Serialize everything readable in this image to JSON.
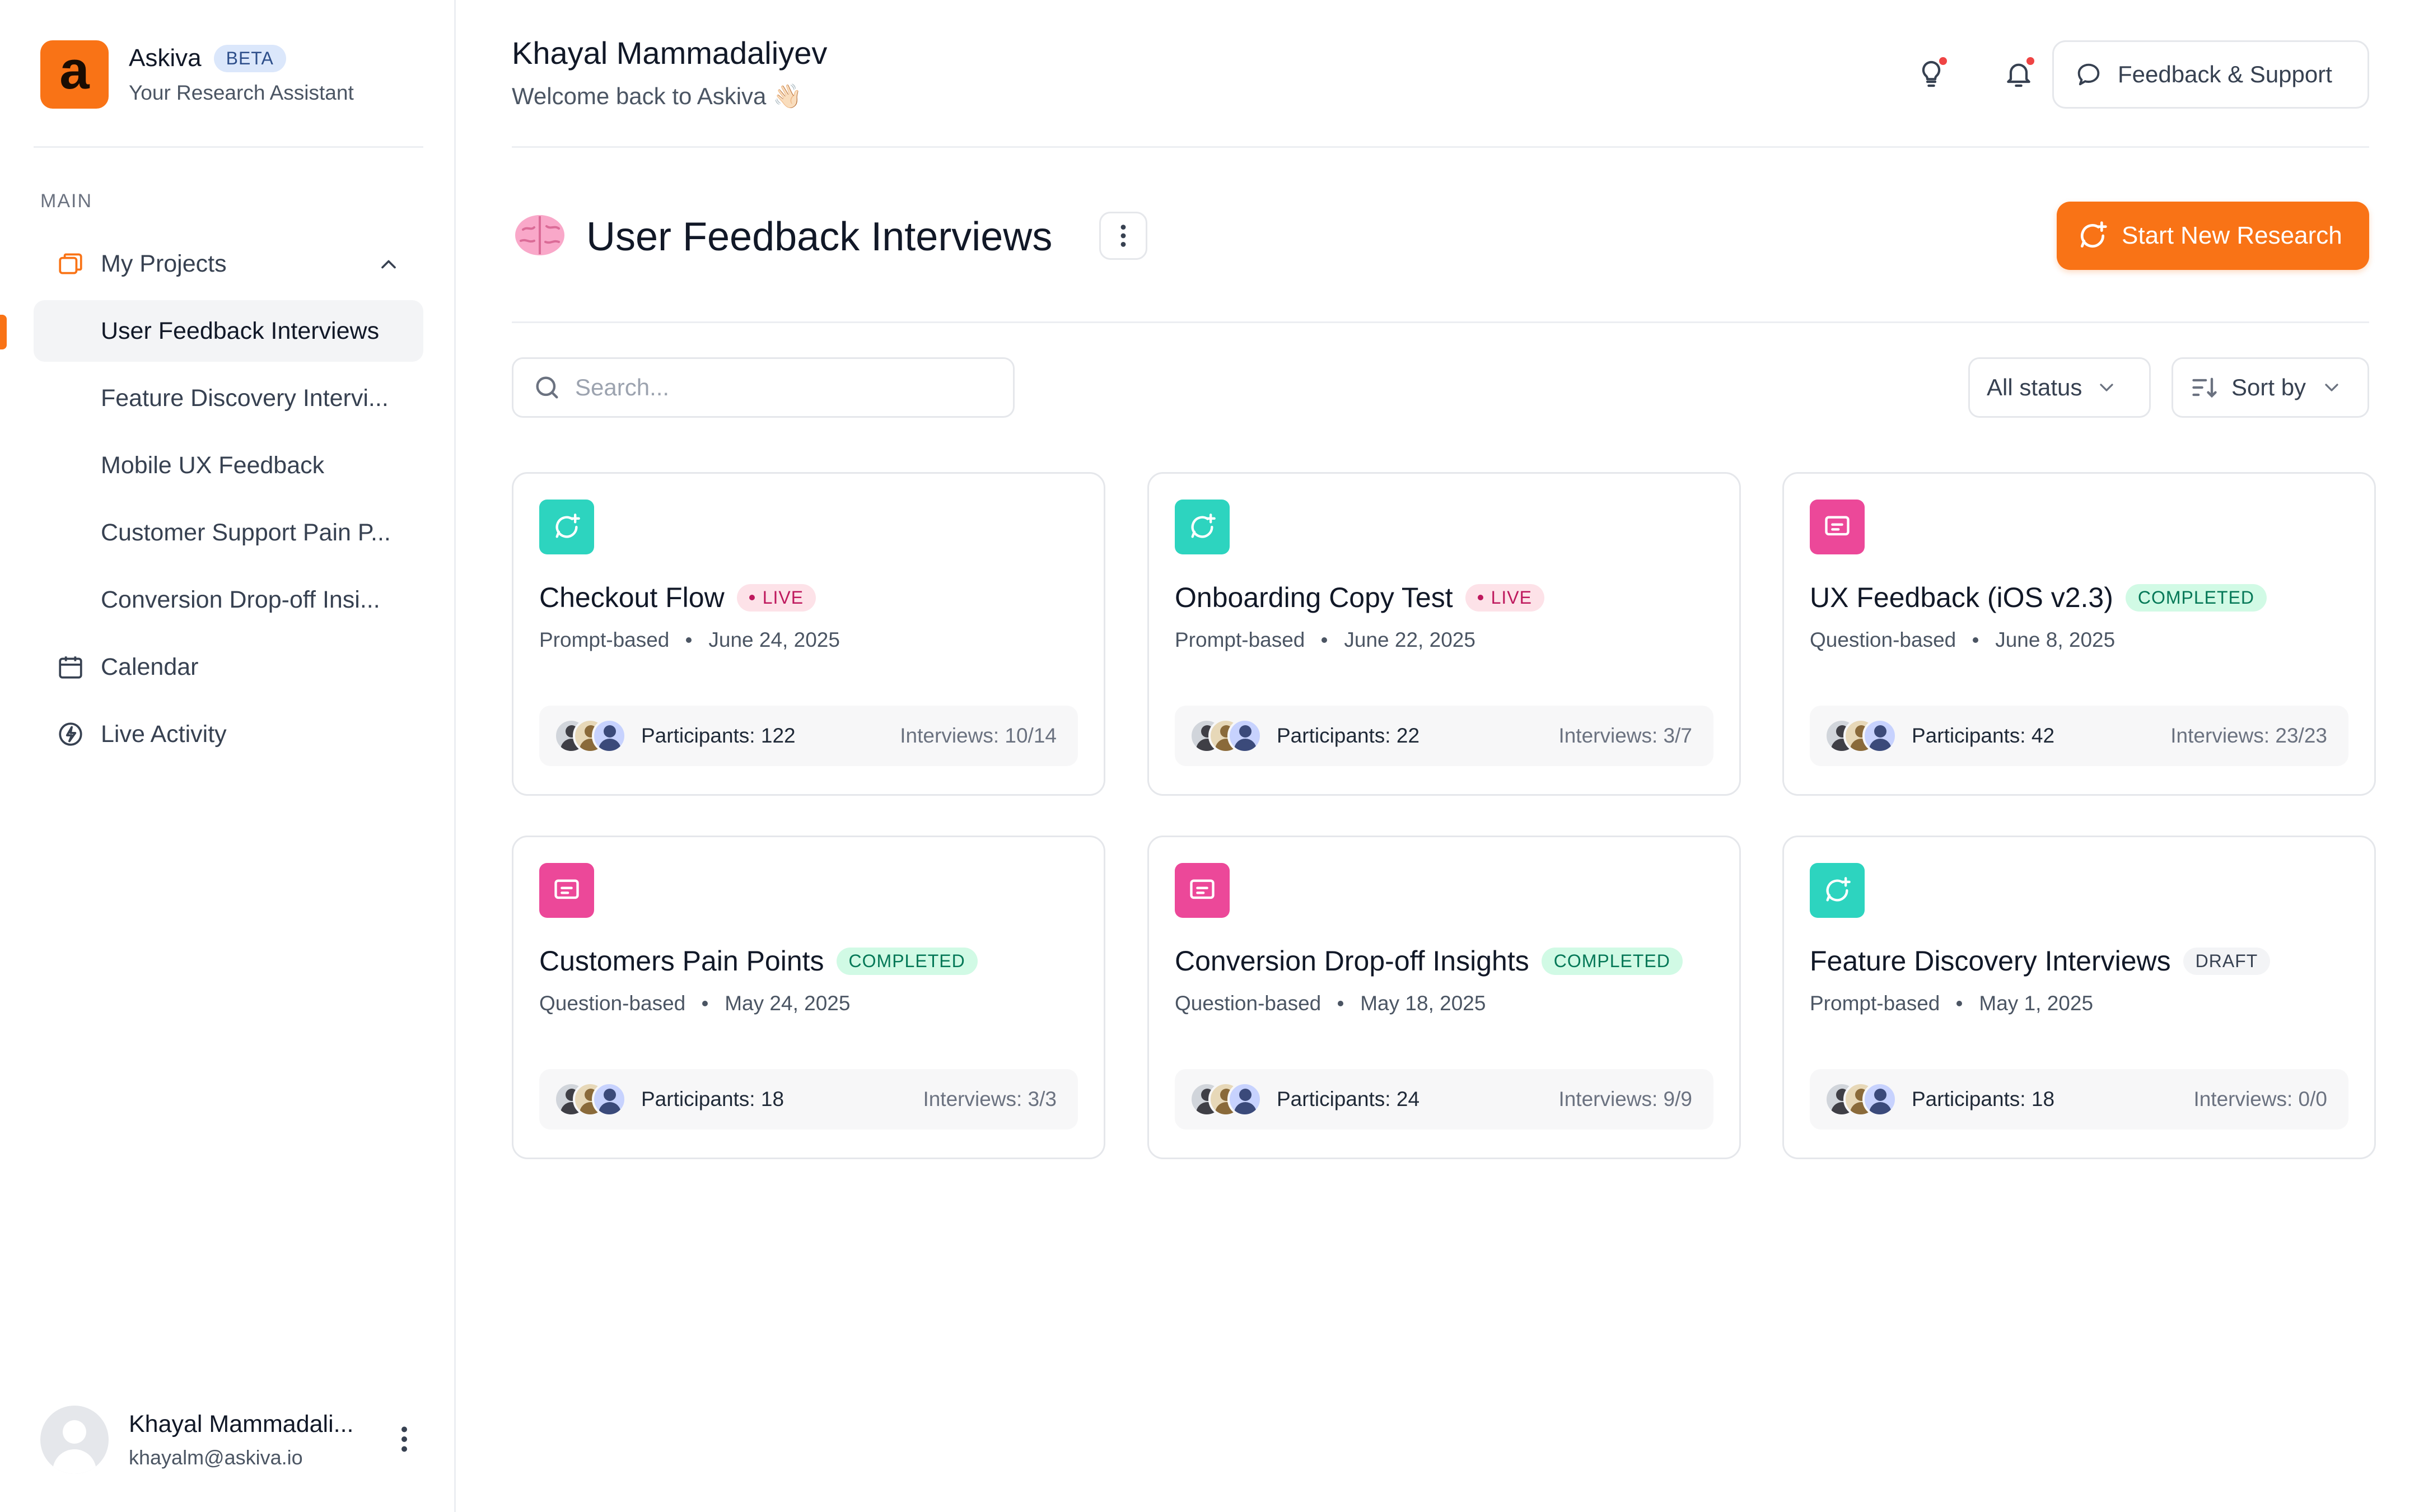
{
  "app": {
    "name": "Askiva",
    "badge": "BETA",
    "subtitle": "Your Research Assistant",
    "logo_letter": "a",
    "accent": "#f97316"
  },
  "sidebar": {
    "section": "MAIN",
    "projects_label": "My Projects",
    "projects": [
      {
        "label": "User Feedback Interviews",
        "active": true
      },
      {
        "label": "Feature Discovery Intervi..."
      },
      {
        "label": "Mobile UX Feedback"
      },
      {
        "label": "Customer Support Pain P..."
      },
      {
        "label": "Conversion Drop-off Insi..."
      }
    ],
    "calendar_label": "Calendar",
    "live_label": "Live Activity",
    "user": {
      "name": "Khayal Mammadali...",
      "email": "khayalm@askiva.io"
    }
  },
  "header": {
    "name": "Khayal Mammadaliyev",
    "welcome": "Welcome back to Askiva 👋🏻",
    "feedback_label": "Feedback & Support"
  },
  "project": {
    "emoji": "🧠",
    "title": "User Feedback Interviews",
    "start_label": "Start New Research"
  },
  "toolbar": {
    "search_placeholder": "Search...",
    "status_label": "All status",
    "sort_label": "Sort by"
  },
  "cards": [
    {
      "title": "Checkout Flow",
      "status": "LIVE",
      "type": "Prompt-based",
      "date": "June 24, 2025",
      "participants": "Participants: 122",
      "interviews": "Interviews: 10/14",
      "icon": "teal"
    },
    {
      "title": "Onboarding Copy Test",
      "status": "LIVE",
      "type": "Prompt-based",
      "date": "June 22, 2025",
      "participants": "Participants: 22",
      "interviews": "Interviews: 3/7",
      "icon": "teal"
    },
    {
      "title": "UX Feedback (iOS v2.3)",
      "status": "COMPLETED",
      "type": "Question-based",
      "date": "June 8, 2025",
      "participants": "Participants: 42",
      "interviews": "Interviews: 23/23",
      "icon": "pink"
    },
    {
      "title": "Customers Pain Points",
      "status": "COMPLETED",
      "type": "Question-based",
      "date": "May 24, 2025",
      "participants": "Participants: 18",
      "interviews": "Interviews: 3/3",
      "icon": "pink"
    },
    {
      "title": "Conversion Drop-off Insights",
      "status": "COMPLETED",
      "type": "Question-based",
      "date": "May 18, 2025",
      "participants": "Participants: 24",
      "interviews": "Interviews: 9/9",
      "icon": "pink"
    },
    {
      "title": "Feature Discovery Interviews",
      "status": "DRAFT",
      "type": "Prompt-based",
      "date": "May 1, 2025",
      "participants": "Participants: 18",
      "interviews": "Interviews: 0/0",
      "icon": "teal"
    }
  ]
}
